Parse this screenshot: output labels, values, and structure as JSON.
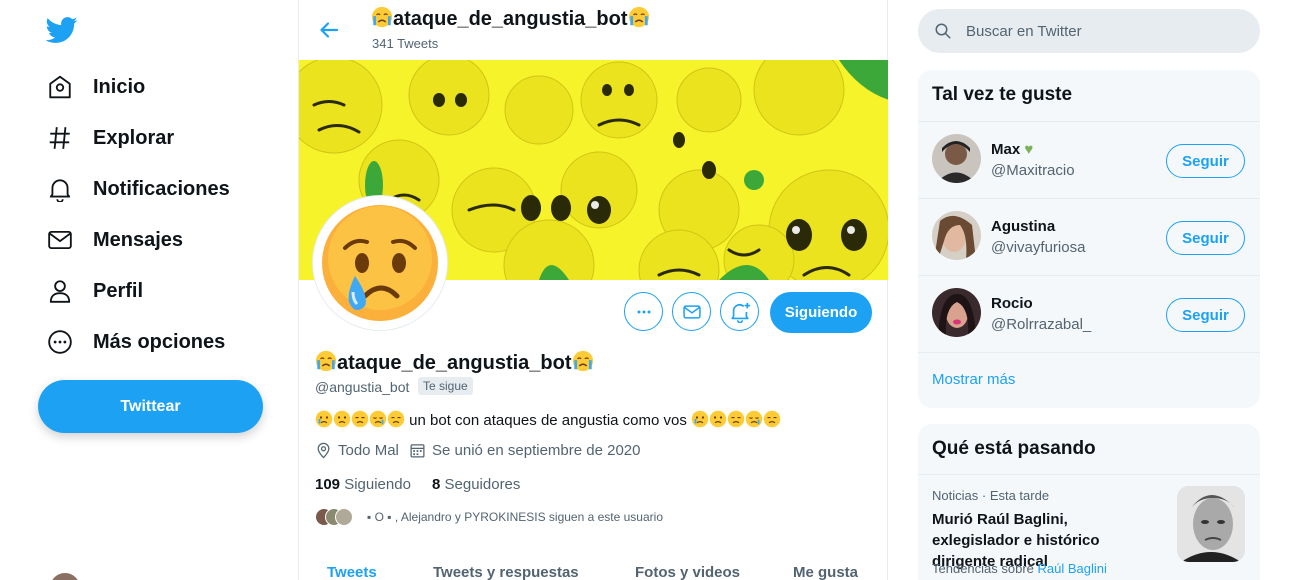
{
  "colors": {
    "accent": "#1da1f2",
    "text": "#0f1419",
    "muted": "#536471",
    "banner": "#f4f12d"
  },
  "nav": {
    "logo_icon": "twitter-bird-icon",
    "items": [
      {
        "label": "Inicio",
        "icon": "home-icon"
      },
      {
        "label": "Explorar",
        "icon": "hashtag-icon"
      },
      {
        "label": "Notificaciones",
        "icon": "bell-icon"
      },
      {
        "label": "Mensajes",
        "icon": "envelope-icon"
      },
      {
        "label": "Perfil",
        "icon": "person-icon"
      },
      {
        "label": "Más opciones",
        "icon": "more-circle-icon"
      }
    ],
    "tweet_label": "Twittear"
  },
  "header": {
    "title": "ataque_de_angustia_bot",
    "tweet_count": "341 Tweets"
  },
  "profile": {
    "name": "ataque_de_angustia_bot",
    "handle": "@angustia_bot",
    "follows_you": "Te sigue",
    "bio_text": "un bot con ataques de angustia como vos",
    "location": "Todo Mal",
    "joined": "Se unió en septiembre de 2020",
    "following_count": "109",
    "following_label": "Siguiendo",
    "followers_count": "8",
    "followers_label": "Seguidores",
    "followed_by": "▪ O ▪ , Alejandro y PYROKINESIS siguen a este usuario",
    "follow_button": "Siguiendo"
  },
  "tabs": [
    "Tweets",
    "Tweets y respuestas",
    "Fotos y videos",
    "Me gusta"
  ],
  "search": {
    "placeholder": "Buscar en Twitter"
  },
  "who_to_follow": {
    "title": "Tal vez te guste",
    "users": [
      {
        "name": "Max",
        "handle": "@Maxitracio",
        "button": "Seguir"
      },
      {
        "name": "Agustina",
        "handle": "@vivayfuriosa",
        "button": "Seguir"
      },
      {
        "name": "Rocio",
        "handle": "@Rolrrazabal_",
        "button": "Seguir"
      }
    ],
    "show_more": "Mostrar más"
  },
  "trends": {
    "title": "Qué está pasando",
    "category": "Noticias",
    "time": "Esta tarde",
    "headline": "Murió Raúl Baglini, exlegislador e histórico dirigente radical",
    "trending_prefix": "Tendencias sobre",
    "trending_link": "Raúl Baglini"
  }
}
